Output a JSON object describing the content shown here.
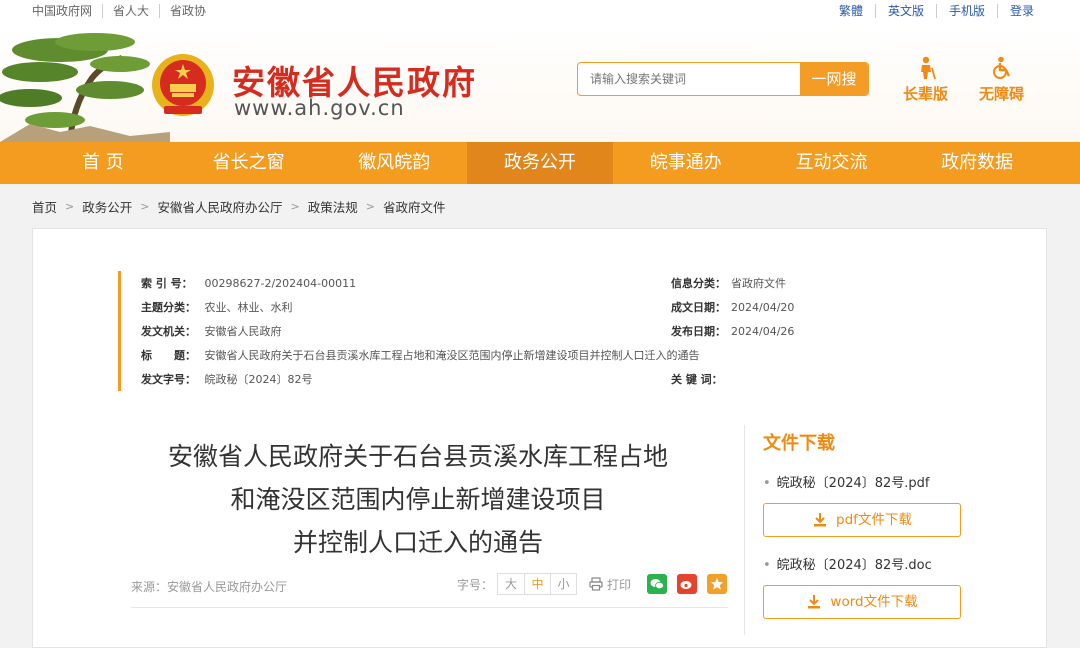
{
  "topbar": {
    "left_links": [
      "中国政府网",
      "省人大",
      "省政协"
    ],
    "right_links": [
      "繁體",
      "英文版",
      "手机版",
      "登录"
    ]
  },
  "header": {
    "site_title": "安徽省人民政府",
    "site_url": "www.ah.gov.cn",
    "search_placeholder": "请输入搜索关键词",
    "search_button": "一网搜",
    "mode_elder": "长辈版",
    "mode_accessible": "无障碍"
  },
  "nav": [
    "首 页",
    "省长之窗",
    "徽风皖韵",
    "政务公开",
    "皖事通办",
    "互动交流",
    "政府数据"
  ],
  "nav_active_index": 3,
  "breadcrumb": [
    "首页",
    "政务公开",
    "安徽省人民政府办公厅",
    "政策法规",
    "省政府文件"
  ],
  "meta": {
    "index_label": "索 引 号：",
    "index_value": "00298627-2/202404-00011",
    "category_label": "信息分类：",
    "category_value": "省政府文件",
    "topic_label": "主题分类：",
    "topic_value": "农业、林业、水利",
    "created_label": "成文日期：",
    "created_value": "2024/04/20",
    "issuer_label": "发文机关：",
    "issuer_value": "安徽省人民政府",
    "published_label": "发布日期：",
    "published_value": "2024/04/26",
    "title_label": "标　　题：",
    "title_value": "安徽省人民政府关于石台县贡溪水库工程占地和淹没区范围内停止新增建设项目并控制人口迁入的通告",
    "docno_label": "发文字号：",
    "docno_value": "皖政秘〔2024〕82号",
    "keyword_label": "关 键 词：",
    "keyword_value": ""
  },
  "article": {
    "title_line1": "安徽省人民政府关于石台县贡溪水库工程占地",
    "title_line2": "和淹没区范围内停止新增建设项目",
    "title_line3": "并控制人口迁入的通告",
    "source": "来源：安徽省人民政府办公厅",
    "font_size_label": "字号：",
    "size_large": "大",
    "size_medium": "中",
    "size_small": "小",
    "print_label": "打印"
  },
  "downloads": {
    "heading": "文件下载",
    "pdf_name": "皖政秘〔2024〕82号.pdf",
    "pdf_button": "pdf文件下载",
    "doc_name": "皖政秘〔2024〕82号.doc",
    "doc_button": "word文件下载"
  },
  "colors": {
    "accent": "#f39c1f",
    "title_red": "#d62b1f",
    "link_blue": "#2b5aa8"
  }
}
